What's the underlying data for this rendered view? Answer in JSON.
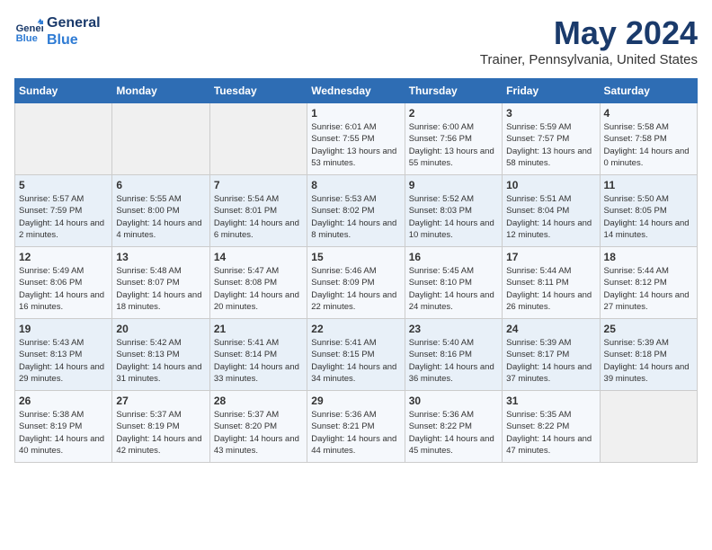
{
  "header": {
    "logo_line1": "General",
    "logo_line2": "Blue",
    "main_title": "May 2024",
    "subtitle": "Trainer, Pennsylvania, United States"
  },
  "days_of_week": [
    "Sunday",
    "Monday",
    "Tuesday",
    "Wednesday",
    "Thursday",
    "Friday",
    "Saturday"
  ],
  "weeks": [
    [
      {
        "day": "",
        "info": ""
      },
      {
        "day": "",
        "info": ""
      },
      {
        "day": "",
        "info": ""
      },
      {
        "day": "1",
        "info": "Sunrise: 6:01 AM\nSunset: 7:55 PM\nDaylight: 13 hours and 53 minutes."
      },
      {
        "day": "2",
        "info": "Sunrise: 6:00 AM\nSunset: 7:56 PM\nDaylight: 13 hours and 55 minutes."
      },
      {
        "day": "3",
        "info": "Sunrise: 5:59 AM\nSunset: 7:57 PM\nDaylight: 13 hours and 58 minutes."
      },
      {
        "day": "4",
        "info": "Sunrise: 5:58 AM\nSunset: 7:58 PM\nDaylight: 14 hours and 0 minutes."
      }
    ],
    [
      {
        "day": "5",
        "info": "Sunrise: 5:57 AM\nSunset: 7:59 PM\nDaylight: 14 hours and 2 minutes."
      },
      {
        "day": "6",
        "info": "Sunrise: 5:55 AM\nSunset: 8:00 PM\nDaylight: 14 hours and 4 minutes."
      },
      {
        "day": "7",
        "info": "Sunrise: 5:54 AM\nSunset: 8:01 PM\nDaylight: 14 hours and 6 minutes."
      },
      {
        "day": "8",
        "info": "Sunrise: 5:53 AM\nSunset: 8:02 PM\nDaylight: 14 hours and 8 minutes."
      },
      {
        "day": "9",
        "info": "Sunrise: 5:52 AM\nSunset: 8:03 PM\nDaylight: 14 hours and 10 minutes."
      },
      {
        "day": "10",
        "info": "Sunrise: 5:51 AM\nSunset: 8:04 PM\nDaylight: 14 hours and 12 minutes."
      },
      {
        "day": "11",
        "info": "Sunrise: 5:50 AM\nSunset: 8:05 PM\nDaylight: 14 hours and 14 minutes."
      }
    ],
    [
      {
        "day": "12",
        "info": "Sunrise: 5:49 AM\nSunset: 8:06 PM\nDaylight: 14 hours and 16 minutes."
      },
      {
        "day": "13",
        "info": "Sunrise: 5:48 AM\nSunset: 8:07 PM\nDaylight: 14 hours and 18 minutes."
      },
      {
        "day": "14",
        "info": "Sunrise: 5:47 AM\nSunset: 8:08 PM\nDaylight: 14 hours and 20 minutes."
      },
      {
        "day": "15",
        "info": "Sunrise: 5:46 AM\nSunset: 8:09 PM\nDaylight: 14 hours and 22 minutes."
      },
      {
        "day": "16",
        "info": "Sunrise: 5:45 AM\nSunset: 8:10 PM\nDaylight: 14 hours and 24 minutes."
      },
      {
        "day": "17",
        "info": "Sunrise: 5:44 AM\nSunset: 8:11 PM\nDaylight: 14 hours and 26 minutes."
      },
      {
        "day": "18",
        "info": "Sunrise: 5:44 AM\nSunset: 8:12 PM\nDaylight: 14 hours and 27 minutes."
      }
    ],
    [
      {
        "day": "19",
        "info": "Sunrise: 5:43 AM\nSunset: 8:13 PM\nDaylight: 14 hours and 29 minutes."
      },
      {
        "day": "20",
        "info": "Sunrise: 5:42 AM\nSunset: 8:13 PM\nDaylight: 14 hours and 31 minutes."
      },
      {
        "day": "21",
        "info": "Sunrise: 5:41 AM\nSunset: 8:14 PM\nDaylight: 14 hours and 33 minutes."
      },
      {
        "day": "22",
        "info": "Sunrise: 5:41 AM\nSunset: 8:15 PM\nDaylight: 14 hours and 34 minutes."
      },
      {
        "day": "23",
        "info": "Sunrise: 5:40 AM\nSunset: 8:16 PM\nDaylight: 14 hours and 36 minutes."
      },
      {
        "day": "24",
        "info": "Sunrise: 5:39 AM\nSunset: 8:17 PM\nDaylight: 14 hours and 37 minutes."
      },
      {
        "day": "25",
        "info": "Sunrise: 5:39 AM\nSunset: 8:18 PM\nDaylight: 14 hours and 39 minutes."
      }
    ],
    [
      {
        "day": "26",
        "info": "Sunrise: 5:38 AM\nSunset: 8:19 PM\nDaylight: 14 hours and 40 minutes."
      },
      {
        "day": "27",
        "info": "Sunrise: 5:37 AM\nSunset: 8:19 PM\nDaylight: 14 hours and 42 minutes."
      },
      {
        "day": "28",
        "info": "Sunrise: 5:37 AM\nSunset: 8:20 PM\nDaylight: 14 hours and 43 minutes."
      },
      {
        "day": "29",
        "info": "Sunrise: 5:36 AM\nSunset: 8:21 PM\nDaylight: 14 hours and 44 minutes."
      },
      {
        "day": "30",
        "info": "Sunrise: 5:36 AM\nSunset: 8:22 PM\nDaylight: 14 hours and 45 minutes."
      },
      {
        "day": "31",
        "info": "Sunrise: 5:35 AM\nSunset: 8:22 PM\nDaylight: 14 hours and 47 minutes."
      },
      {
        "day": "",
        "info": ""
      }
    ]
  ]
}
